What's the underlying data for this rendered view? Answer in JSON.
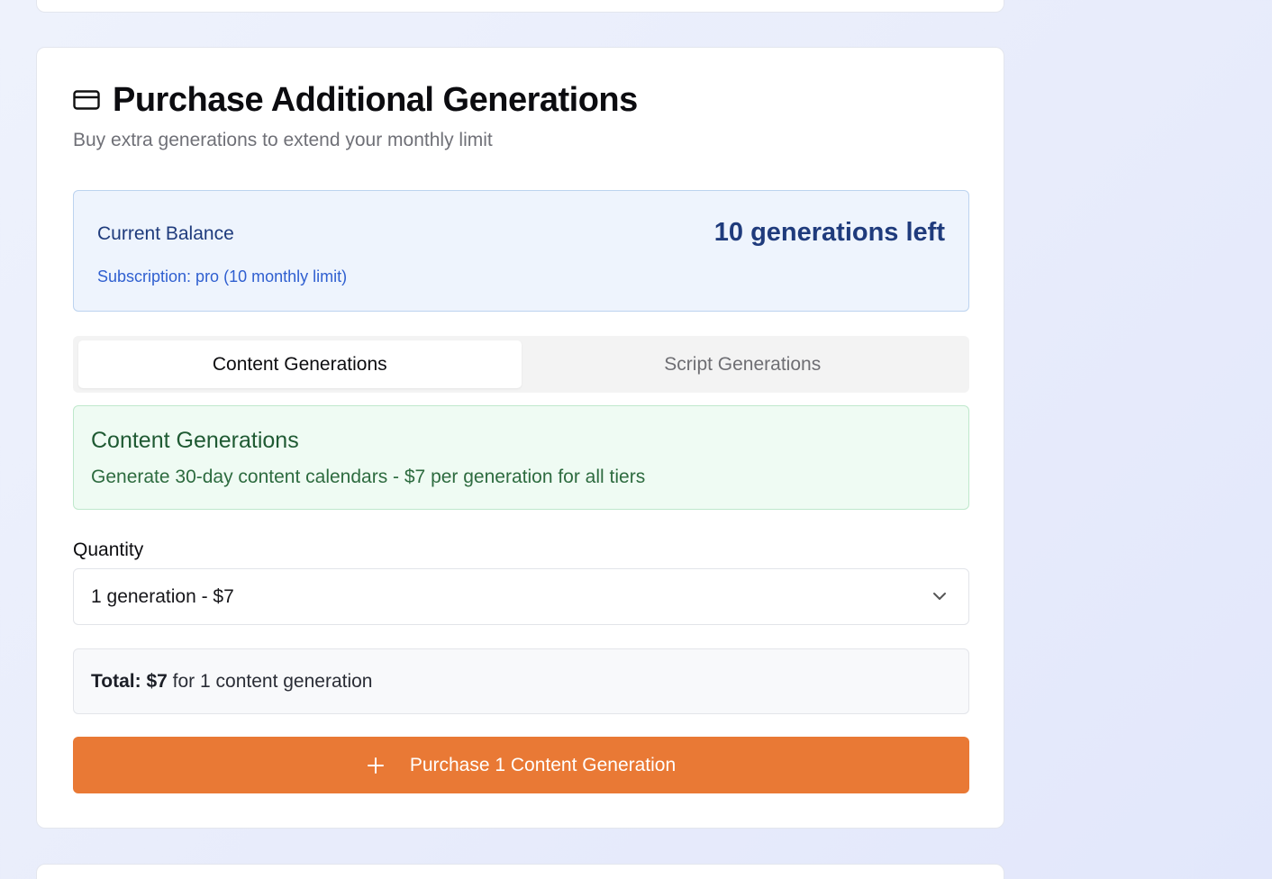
{
  "header": {
    "title": "Purchase Additional Generations",
    "subtitle": "Buy extra generations to extend your monthly limit",
    "icon": "credit-card-icon"
  },
  "balance": {
    "label": "Current Balance",
    "remaining": "10 generations left",
    "subscription": "Subscription: pro (10 monthly limit)"
  },
  "tabs": [
    {
      "label": "Content Generations",
      "active": true
    },
    {
      "label": "Script Generations",
      "active": false
    }
  ],
  "info": {
    "title": "Content Generations",
    "description": "Generate 30-day content calendars - $7 per generation for all tiers"
  },
  "quantity": {
    "label": "Quantity",
    "selected": "1 generation - $7",
    "icon": "chevron-down-icon"
  },
  "total": {
    "label": "Total:",
    "amount": "$7",
    "suffix": "for 1 content generation"
  },
  "purchase": {
    "label": "Purchase 1 Content Generation",
    "icon": "plus-icon"
  },
  "colors": {
    "accent": "#e97935",
    "balance_bg": "#eef4fd",
    "balance_text": "#1f3b7c",
    "info_bg": "#effbf3",
    "info_text": "#1f5a33"
  }
}
